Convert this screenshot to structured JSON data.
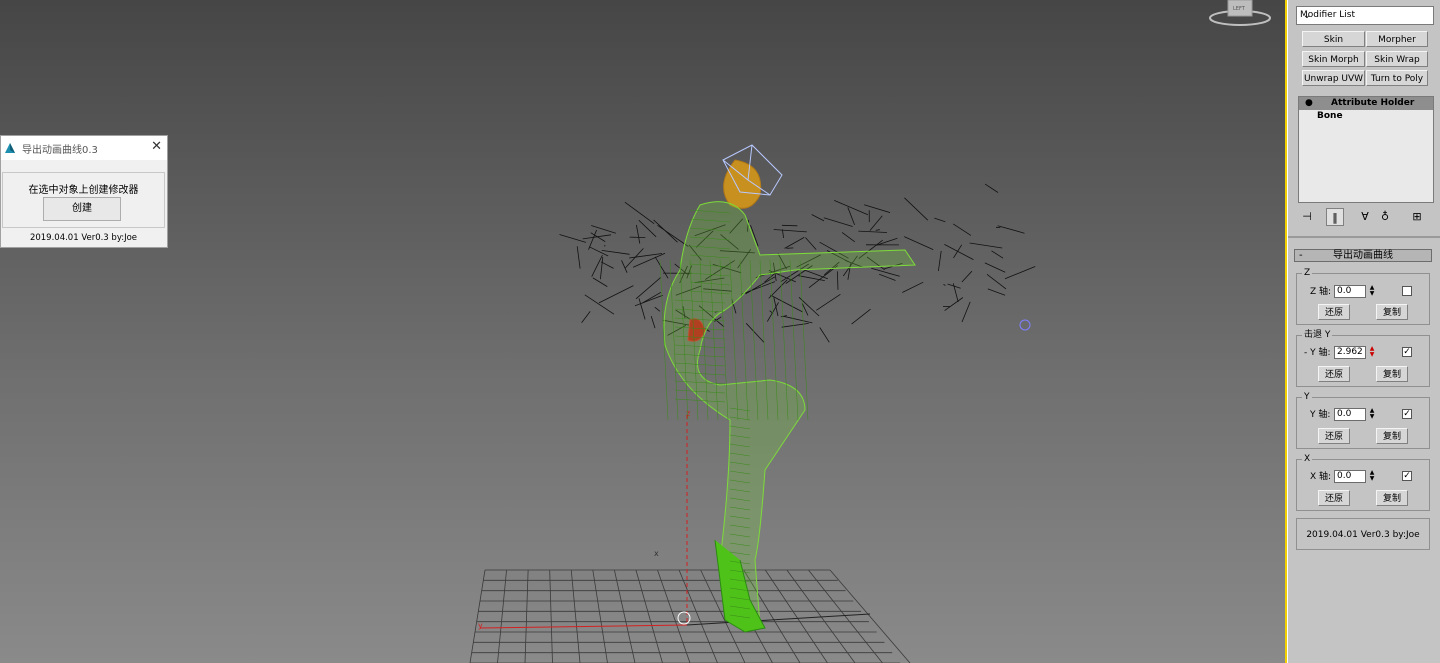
{
  "dialog": {
    "title": "导出动画曲线0.3",
    "close": "✕",
    "label": "在选中对象上创建修改器",
    "create_button": "创建",
    "version": "2019.04.01 Ver0.3 by:Joe"
  },
  "panel": {
    "modifier_list": "Modifier List",
    "buttons": [
      "Skin",
      "Morpher",
      "Skin Morph",
      "Skin Wrap",
      "Unwrap UVW",
      "Turn to Poly"
    ],
    "stack_header": "Attribute Holder",
    "stack_item": "Bone",
    "rollout_title": "导出动画曲线",
    "rollout_minus": "-",
    "groups": [
      {
        "label": "Z",
        "axis_label": "Z 轴:",
        "value": "0.0",
        "checked": false,
        "restore": "还原",
        "copy": "复制"
      },
      {
        "label": "击退 Y",
        "axis_label": "- Y 轴:",
        "value": "2.962",
        "checked": true,
        "restore": "还原",
        "copy": "复制"
      },
      {
        "label": "Y",
        "axis_label": "Y 轴:",
        "value": "0.0",
        "checked": true,
        "restore": "还原",
        "copy": "复制"
      },
      {
        "label": "X",
        "axis_label": "X 轴:",
        "value": "0.0",
        "checked": true,
        "restore": "还原",
        "copy": "复制"
      }
    ],
    "footer": "2019.04.01 Ver0.3 by:Joe"
  },
  "viewport": {
    "axis_z": "z",
    "axis_y": "y",
    "axis_x": "x",
    "viewcube_label": "LEFT"
  },
  "colors": {
    "wire_green": "#7ddc3a",
    "wire_dark": "#111111",
    "axis_red": "#d42020",
    "accent_yellow": "#f0d000"
  }
}
